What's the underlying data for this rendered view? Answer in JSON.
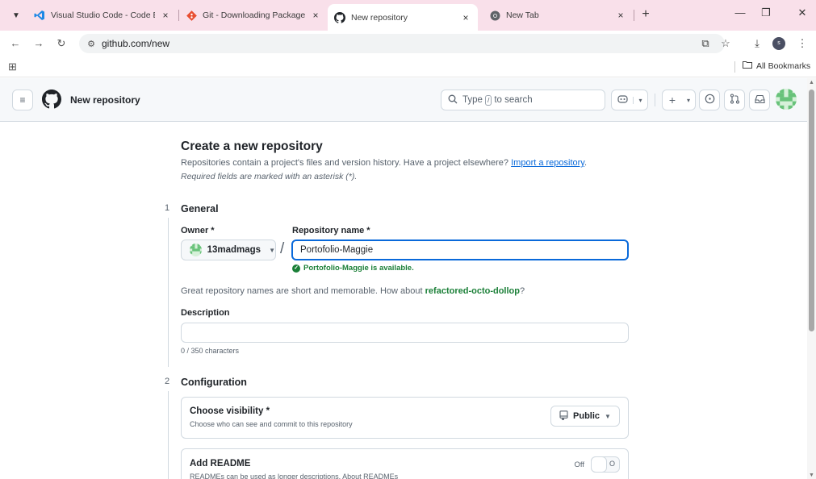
{
  "browser": {
    "tabs": [
      {
        "title": "Visual Studio Code - Code Editi",
        "icon": "vscode-icon",
        "active": false
      },
      {
        "title": "Git - Downloading Package",
        "icon": "git-icon",
        "active": false
      },
      {
        "title": "New repository",
        "icon": "github-icon",
        "active": true
      },
      {
        "title": "New Tab",
        "icon": "chrome-icon",
        "active": false
      }
    ],
    "tab_close_glyph": "×",
    "new_tab_glyph": "+",
    "url": "github.com/new",
    "bookmarks": {
      "all_label": "All Bookmarks"
    },
    "profile_initial": "s"
  },
  "github": {
    "header": {
      "context_title": "New repository",
      "search_prefix": "Type",
      "search_key": "/",
      "search_suffix": "to search"
    },
    "page": {
      "title": "Create a new repository",
      "description": "Repositories contain a project's files and version history. Have a project elsewhere?",
      "import_link": "Import a repository",
      "description_end": ".",
      "required_note": "Required fields are marked with an asterisk (*)."
    },
    "general": {
      "step": "1",
      "title": "General",
      "owner_label": "Owner *",
      "owner_value": "13madmags",
      "repo_label": "Repository name *",
      "repo_value": "Portofolio-Maggie",
      "availability": "Portofolio-Maggie is available.",
      "suggestion_prefix": "Great repository names are short and memorable. How about",
      "suggestion_name": "refactored-octo-dollop",
      "suggestion_suffix": "?",
      "description_label": "Description",
      "description_value": "",
      "char_count": "0 / 350 characters"
    },
    "configuration": {
      "step": "2",
      "title": "Configuration",
      "visibility_title": "Choose visibility *",
      "visibility_sub": "Choose who can see and commit to this repository",
      "visibility_value": "Public",
      "readme_title": "Add README",
      "readme_sub": "READMEs can be used as longer descriptions. About READMEs",
      "readme_toggle_state": "Off",
      "readme_toggle_glyph": "O"
    }
  },
  "colors": {
    "tabbar": "#f9e0ea",
    "link": "#0969da",
    "success": "#1a7f37",
    "focus_border": "#0969da"
  }
}
